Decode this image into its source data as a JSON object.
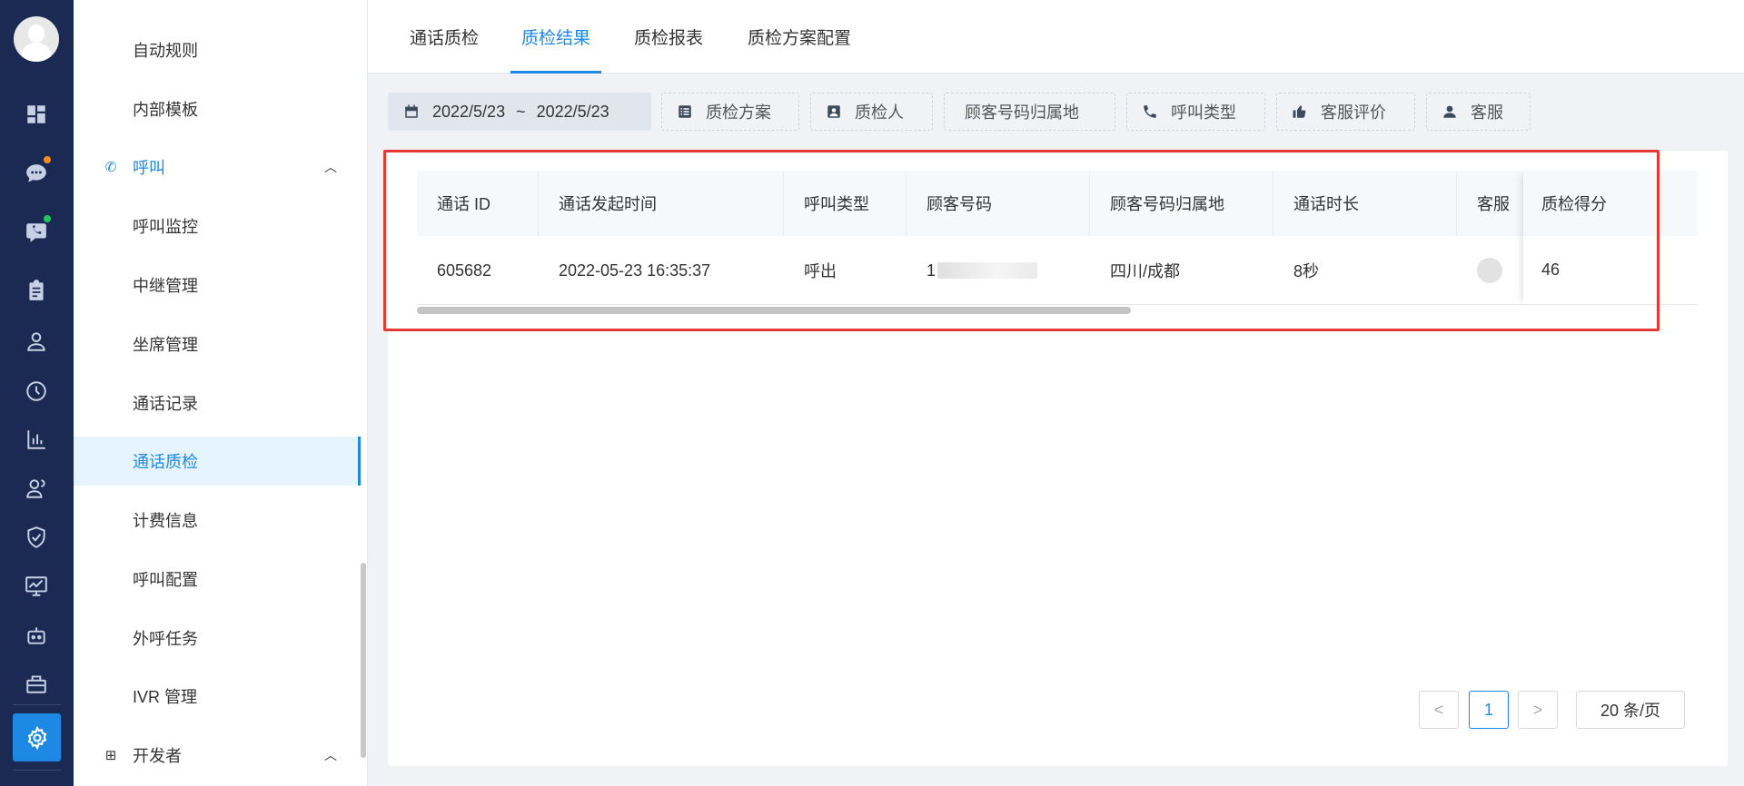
{
  "sidebar": {
    "items": [
      {
        "label": "自动规则"
      },
      {
        "label": "内部模板"
      },
      {
        "label": "呼叫",
        "type": "group",
        "expanded": true
      },
      {
        "label": "呼叫监控"
      },
      {
        "label": "中继管理"
      },
      {
        "label": "坐席管理"
      },
      {
        "label": "通话记录"
      },
      {
        "label": "通话质检",
        "active": true
      },
      {
        "label": "计费信息"
      },
      {
        "label": "呼叫配置"
      },
      {
        "label": "外呼任务"
      },
      {
        "label": "IVR 管理"
      },
      {
        "label": "开发者",
        "type": "group",
        "expanded": true
      }
    ]
  },
  "rail_icons": [
    "dashboard-icon",
    "chat-icon",
    "phone-chat-icon",
    "clipboard-icon",
    "user-icon",
    "clock-icon",
    "bar-chart-icon",
    "team-icon",
    "shield-icon",
    "monitor-chart-icon",
    "robot-icon",
    "toolbox-icon",
    "settings-icon"
  ],
  "badges": {
    "chat": "#ff8c1a",
    "phone_chat": "#22c55e"
  },
  "tabs": [
    {
      "label": "通话质检"
    },
    {
      "label": "质检结果",
      "active": true
    },
    {
      "label": "质检报表"
    },
    {
      "label": "质检方案配置"
    }
  ],
  "filters": {
    "date_start": "2022/5/23",
    "date_sep": "~",
    "date_end": "2022/5/23",
    "plan": "质检方案",
    "inspector": "质检人",
    "region": "顾客号码归属地",
    "call_type": "呼叫类型",
    "rating": "客服评价",
    "agent": "客服"
  },
  "table": {
    "columns": [
      "通话 ID",
      "通话发起时间",
      "呼叫类型",
      "顾客号码",
      "顾客号码归属地",
      "通话时长",
      "客服",
      "质检得分"
    ],
    "rows": [
      {
        "id": "605682",
        "time": "2022-05-23 16:35:37",
        "type": "呼出",
        "phone": "1",
        "region": "四川/成都",
        "duration": "8秒",
        "score": "46"
      }
    ]
  },
  "pagination": {
    "prev": "<",
    "current": "1",
    "next": ">",
    "page_size": "20 条/页"
  },
  "colors": {
    "accent": "#1e88e5",
    "rail_bg": "#1b2a52",
    "highlight": "#e53935"
  }
}
